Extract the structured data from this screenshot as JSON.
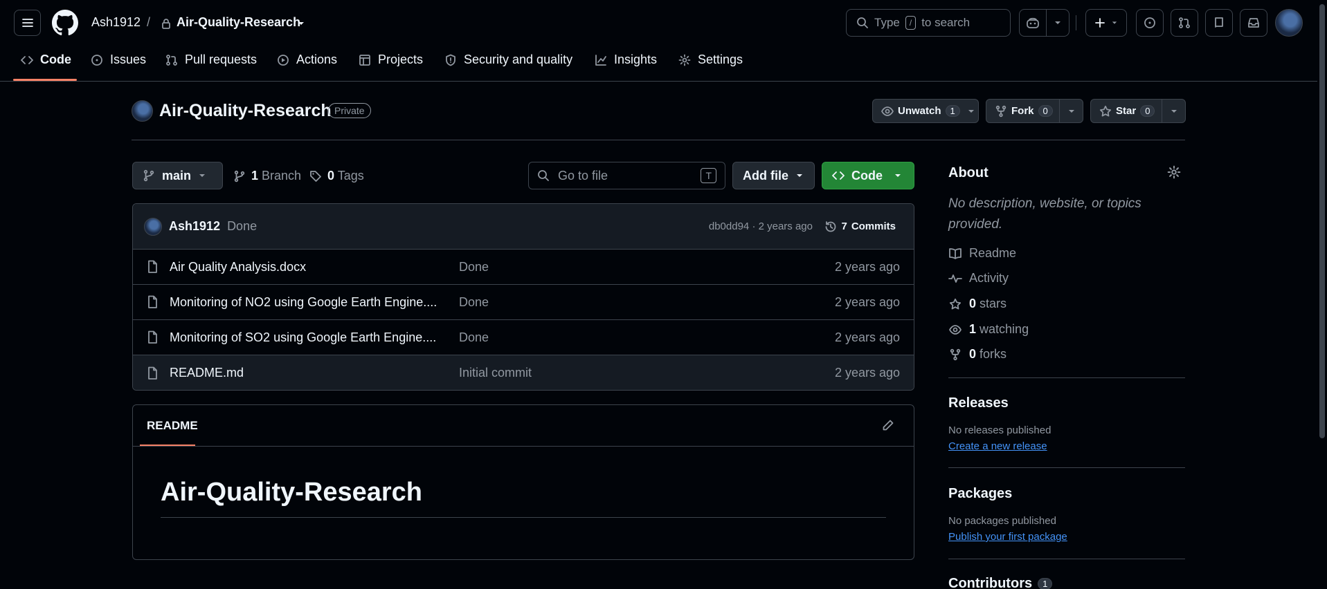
{
  "header": {
    "owner": "Ash1912",
    "separator": "/",
    "repo": "Air-Quality-Research",
    "search_prefix": "Type",
    "search_key": "/",
    "search_suffix": "to search"
  },
  "tabs": [
    {
      "label": "Code",
      "icon": "code-icon",
      "selected": true
    },
    {
      "label": "Issues",
      "icon": "issue-icon"
    },
    {
      "label": "Pull requests",
      "icon": "pull-request-icon"
    },
    {
      "label": "Actions",
      "icon": "play-icon"
    },
    {
      "label": "Projects",
      "icon": "table-icon"
    },
    {
      "label": "Security and quality",
      "icon": "shield-icon"
    },
    {
      "label": "Insights",
      "icon": "graph-icon"
    },
    {
      "label": "Settings",
      "icon": "gear-icon"
    }
  ],
  "repo": {
    "name": "Air-Quality-Research",
    "visibility": "Private",
    "unwatch_label": "Unwatch",
    "unwatch_count": "1",
    "fork_label": "Fork",
    "fork_count": "0",
    "star_label": "Star",
    "star_count": "0"
  },
  "filenav": {
    "branch": "main",
    "branch_count": "1",
    "branch_label": "Branch",
    "tag_count": "0",
    "tag_label": "Tags",
    "goto_placeholder": "Go to file",
    "goto_key": "T",
    "add_file": "Add file",
    "code": "Code"
  },
  "commit": {
    "author": "Ash1912",
    "message": "Done",
    "hash_time": "db0dd94 · 2 years ago",
    "commits_count": "7",
    "commits_label": "Commits"
  },
  "files": [
    {
      "name": "Air Quality Analysis.docx",
      "message": "Done",
      "date": "2 years ago"
    },
    {
      "name": "Monitoring of NO2 using Google Earth Engine....",
      "message": "Done",
      "date": "2 years ago"
    },
    {
      "name": "Monitoring of SO2 using Google Earth Engine....",
      "message": "Done",
      "date": "2 years ago"
    },
    {
      "name": "README.md",
      "message": "Initial commit",
      "date": "2 years ago"
    }
  ],
  "readme": {
    "tab": "README",
    "heading": "Air-Quality-Research"
  },
  "sidebar": {
    "about_title": "About",
    "description": "No description, website, or topics provided.",
    "readme": "Readme",
    "activity": "Activity",
    "stars_count": "0",
    "stars_label": "stars",
    "watching_count": "1",
    "watching_label": "watching",
    "forks_count": "0",
    "forks_label": "forks",
    "releases_title": "Releases",
    "releases_none": "No releases published",
    "releases_link": "Create a new release",
    "packages_title": "Packages",
    "packages_none": "No packages published",
    "packages_link": "Publish your first package",
    "contributors_title": "Contributors",
    "contributors_count": "1"
  },
  "colors": {
    "background": "#010409",
    "border": "#3d444d",
    "text": "#f0f6fc",
    "muted": "#9198a1",
    "accent_underline": "#f78166",
    "green_button": "#238636",
    "link": "#4493f8"
  }
}
